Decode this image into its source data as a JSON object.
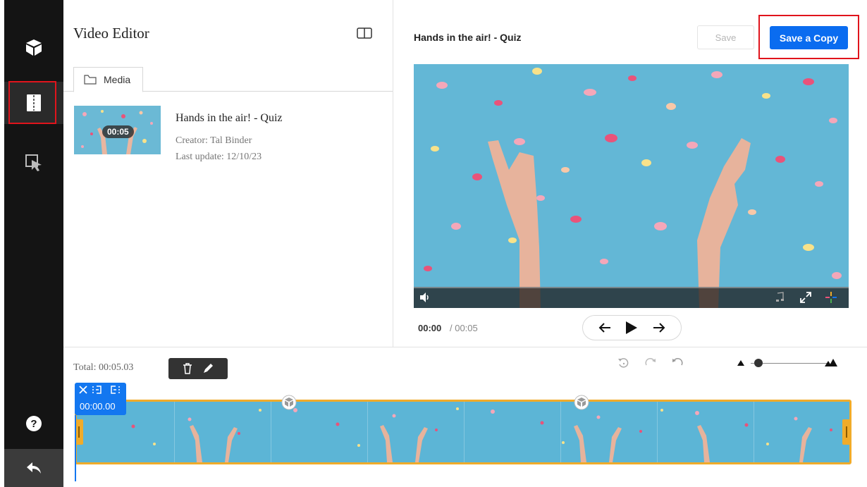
{
  "sidebar": {
    "items": [
      {
        "icon": "cube-icon",
        "label": ""
      },
      {
        "icon": "editor-icon",
        "label": ""
      },
      {
        "icon": "pointer-icon",
        "label": ""
      }
    ],
    "help_icon": "question-icon",
    "back_icon": "back-arrow-icon"
  },
  "left_pane": {
    "title": "Video Editor",
    "layout_icon": "split-panel-icon",
    "tabs": [
      {
        "label": "Media",
        "icon": "folder-icon"
      }
    ],
    "entries": [
      {
        "title": "Hands in the air! - Quiz",
        "duration": "00:05",
        "creator": "Creator: Tal Binder",
        "last_update": "Last update: 12/10/23"
      }
    ]
  },
  "right_pane": {
    "video_title": "Hands in the air! - Quiz",
    "save_label": "Save",
    "save_copy_label": "Save a Copy",
    "current_time": "00:00",
    "duration_text": "/  00:05"
  },
  "timeline": {
    "total": "Total: 00:05.03",
    "playhead_time": "00:00.00",
    "zoom_level": 0.1
  },
  "colors": {
    "accent": "#0a6cf0",
    "highlight": "#e0141c",
    "clip_border": "#f0ab2a",
    "rail": "#141414",
    "video_bg": "#63b7d6"
  }
}
